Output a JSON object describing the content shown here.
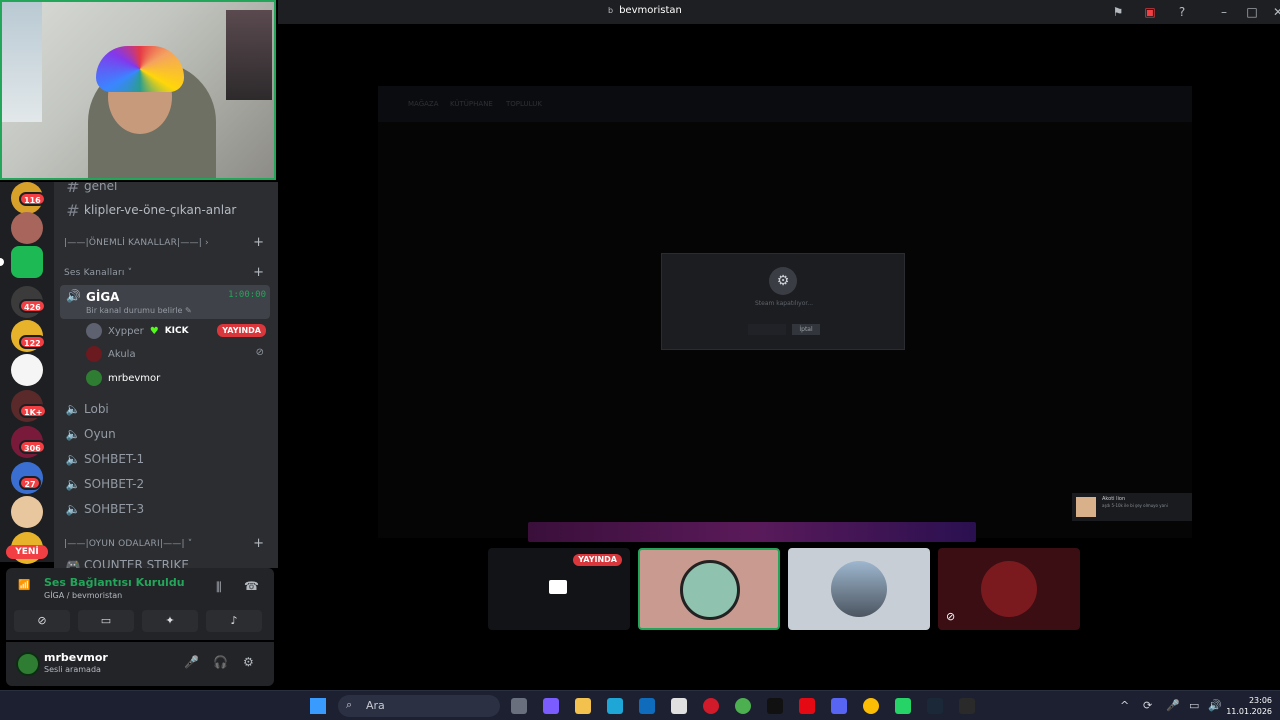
{
  "window": {
    "title": "bevmoristan",
    "icons": [
      "flag-icon",
      "screen-icon",
      "help-icon",
      "minimize-icon",
      "maximize-icon",
      "close-icon"
    ]
  },
  "sidebar": {
    "server_badges": [
      "116",
      "426",
      "122",
      "1K+",
      "306",
      "27"
    ],
    "new_label": "YENİ"
  },
  "channels": {
    "text": [
      {
        "name": "genel"
      },
      {
        "name": "klipler-ve-öne-çıkan-anlar"
      }
    ],
    "category_important": "|——|ÖNEMLİ KANALLAR|——| ›",
    "category_voice": "Ses Kanalları ˅",
    "active_voice": {
      "name": "GİGA",
      "timer": "1:00:00",
      "status": "Bir kanal durumu belirle ✎"
    },
    "members": [
      {
        "name": "Xypper",
        "extra": "KICK",
        "live": "YAYINDA"
      },
      {
        "name": "Akula",
        "extra": "",
        "live": ""
      },
      {
        "name": "mrbevmor",
        "extra": "",
        "live": ""
      }
    ],
    "voice_channels": [
      "Lobi",
      "Oyun",
      "SOHBET-1",
      "SOHBET-2",
      "SOHBET-3"
    ],
    "category_games": "|——|OYUN ODALARI|——| ˅",
    "partial_channel": "COUNTER STRIKE"
  },
  "voice_panel": {
    "title": "Ses Bağlantısı Kuruldu",
    "subtitle": "GİGA / bevmoristan"
  },
  "user_panel": {
    "name": "mrbevmor",
    "status": "Sesli aramada"
  },
  "stage": {
    "steam_nav": [
      "MAĞAZA",
      "KÜTÜPHANE",
      "TOPLULUK"
    ],
    "dialog_text": "Steam kapatılıyor...",
    "dialog_button": "İptal",
    "toast_name": "Akoti lion",
    "toast_msg": "aşdı 5-10k ile bi şey olmuyo yani",
    "tile_live_label": "YAYINDA"
  },
  "taskbar": {
    "search_label": "Ara",
    "time": "23:06",
    "date": "11.01.2026"
  },
  "colors": {
    "discord_green": "#23a55a",
    "discord_red": "#da373c",
    "sidebar_bg": "#2b2d31",
    "rail_bg": "#1e1f22"
  }
}
